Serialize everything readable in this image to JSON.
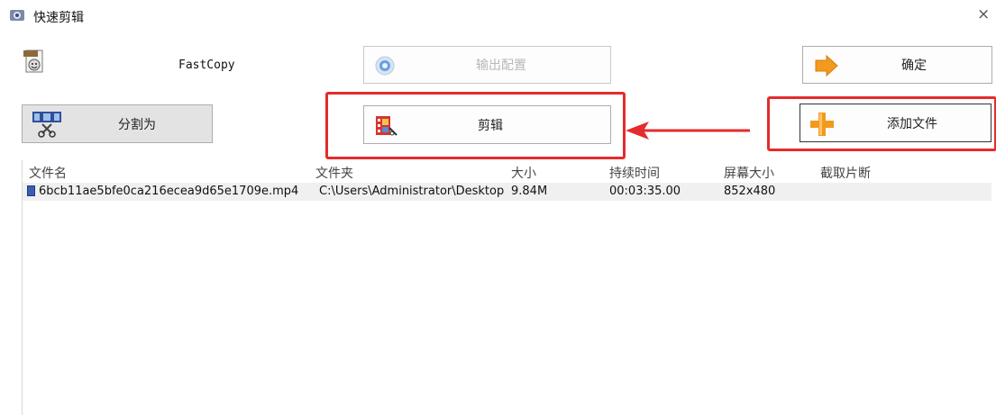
{
  "window": {
    "title": "快速剪辑",
    "close_glyph": "×"
  },
  "fastcopy": {
    "label": "FastCopy",
    "icon": "mp4-file-icon"
  },
  "buttons": {
    "split": {
      "label": "分割为",
      "icon": "film-scissors-icon"
    },
    "output_config": {
      "label": "输出配置",
      "icon": "gear-disc-icon",
      "disabled": true
    },
    "ok": {
      "label": "确定",
      "icon": "orange-arrow-icon"
    },
    "cut": {
      "label": "剪辑",
      "icon": "film-clip-icon"
    },
    "add_file": {
      "label": "添加文件",
      "icon": "orange-plus-icon"
    }
  },
  "table": {
    "headers": [
      "文件名",
      "文件夹",
      "大小",
      "持续时间",
      "屏幕大小",
      "截取片断"
    ],
    "rows": [
      [
        "6bcb11ae5bfe0ca216ecea9d65e1709e.mp4",
        "C:\\Users\\Administrator\\Desktop",
        "9.84M",
        "00:03:35.00",
        "852x480",
        ""
      ]
    ]
  },
  "colors": {
    "highlight": "#e52b2b",
    "accent_orange": "#f39a1e",
    "disabled_text": "#b8b8b8"
  }
}
